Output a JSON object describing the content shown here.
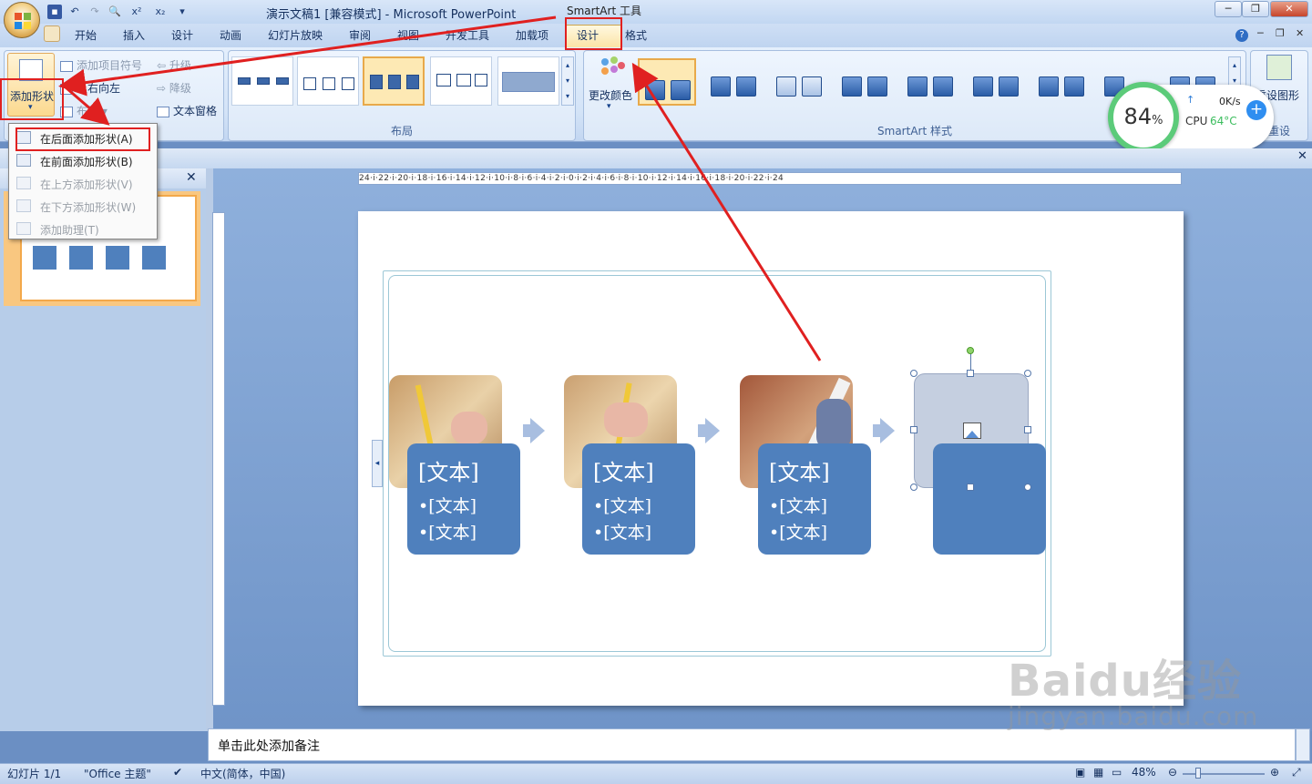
{
  "titlebar": {
    "title": "演示文稿1 [兼容模式] - Microsoft PowerPoint",
    "contextual": "SmartArt 工具",
    "qat_icons": [
      "save-icon",
      "undo-icon",
      "redo-icon",
      "print-preview-icon",
      "superscript-icon",
      "subscript-icon"
    ],
    "qat_labels": [
      "x²",
      "x₂"
    ]
  },
  "tabs": [
    "开始",
    "插入",
    "设计",
    "动画",
    "幻灯片放映",
    "审阅",
    "视图",
    "开发工具",
    "加载项",
    "设计",
    "格式"
  ],
  "ribbon": {
    "create_group": {
      "add_shape": "添加形状",
      "add_bullet": "添加项目符号",
      "right_to_left": "从右向左",
      "layout": "布局",
      "promote": "升级",
      "demote": "降级",
      "text_pane": "文本窗格"
    },
    "layout_label": "布局",
    "change_colors": "更改颜色",
    "styles_label": "SmartArt 样式",
    "reset_graphic": "重设图形",
    "reset_label": "重设"
  },
  "menu": {
    "items": [
      {
        "label": "在后面添加形状(A)",
        "enabled": true
      },
      {
        "label": "在前面添加形状(B)",
        "enabled": true
      },
      {
        "label": "在上方添加形状(V)",
        "enabled": false
      },
      {
        "label": "在下方添加形状(W)",
        "enabled": false
      },
      {
        "label": "添加助理(T)",
        "enabled": false
      }
    ]
  },
  "widget": {
    "percent": "84",
    "percent_unit": "%",
    "speed": "0K/s",
    "cpu_label": "CPU",
    "cpu_temp": "64°C",
    "ring_color": "#5ccb7a"
  },
  "ruler": {
    "h_labels": "24·i·22·i·20·i·18·i·16·i·14·i·12·i·10·i·8·i·6·i·4·i·2·i·0·i·2·i·4·i·6·i·8·i·10·i·12·i·14·i·16·i·18·i·20·i·22·i·24"
  },
  "smartart": {
    "cards": [
      {
        "title": "[文本]",
        "bullets": [
          "•[文本]",
          "•[文本]"
        ]
      },
      {
        "title": "[文本]",
        "bullets": [
          "•[文本]",
          "•[文本]"
        ]
      },
      {
        "title": "[文本]",
        "bullets": [
          "•[文本]",
          "•[文本]"
        ]
      }
    ],
    "card_color": "#4f80bd"
  },
  "notes": {
    "placeholder": "单击此处添加备注"
  },
  "status": {
    "slide": "幻灯片 1/1",
    "theme": "\"Office 主题\"",
    "language": "中文(简体，中国)",
    "zoom": "48%"
  },
  "watermark": {
    "brand": "Baidu经验",
    "url": "jingyan.baidu.com"
  },
  "annotation_color": "#e02020"
}
